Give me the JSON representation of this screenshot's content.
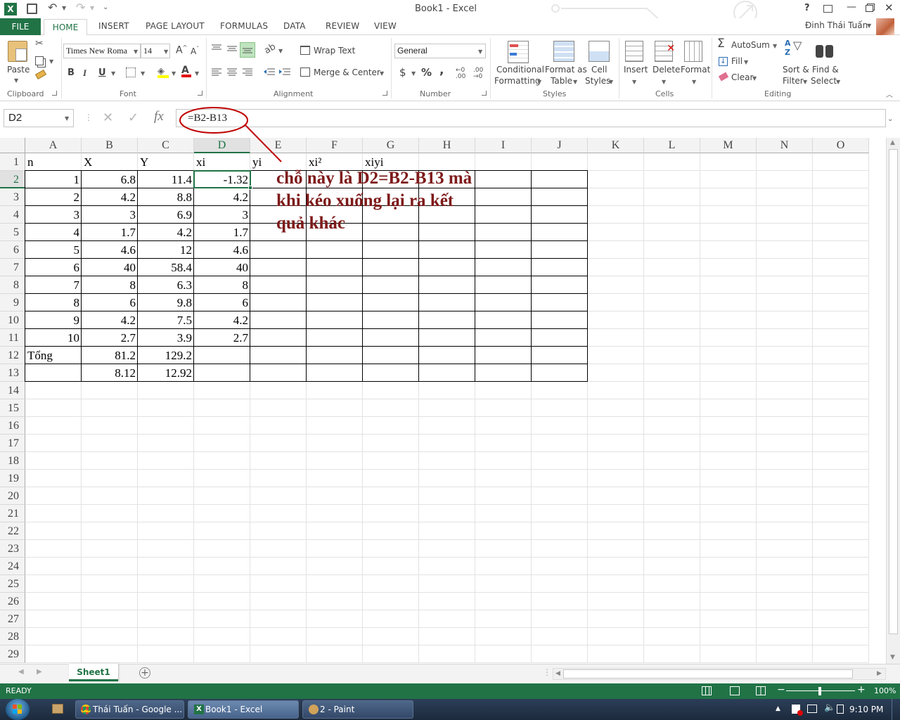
{
  "window": {
    "title": "Book1 - Excel",
    "help": "?",
    "user": "Đinh Thái Tuấn"
  },
  "tabs": [
    "FILE",
    "HOME",
    "INSERT",
    "PAGE LAYOUT",
    "FORMULAS",
    "DATA",
    "REVIEW",
    "VIEW"
  ],
  "ribbon": {
    "clipboard": {
      "paste": "Paste",
      "label": "Clipboard"
    },
    "font": {
      "name": "Times New Roma",
      "size": "14",
      "label": "Font",
      "bold": "B",
      "italic": "I",
      "underline": "U"
    },
    "alignment": {
      "wrap": "Wrap Text",
      "merge": "Merge & Center",
      "label": "Alignment"
    },
    "number": {
      "format": "General",
      "currency": "$",
      "percent": "%",
      "comma": ",",
      "label": "Number"
    },
    "styles": {
      "conditional": "Conditional",
      "conditional2": "Formatting",
      "format_table": "Format as",
      "format_table2": "Table",
      "cell_styles": "Cell",
      "cell_styles2": "Styles",
      "label": "Styles"
    },
    "cells": {
      "insert": "Insert",
      "delete": "Delete",
      "format": "Format",
      "label": "Cells"
    },
    "editing": {
      "autosum": "AutoSum",
      "fill": "Fill",
      "clear": "Clear",
      "sort": "Sort &",
      "sort2": "Filter",
      "find": "Find &",
      "find2": "Select",
      "label": "Editing"
    }
  },
  "formula_bar": {
    "name_box": "D2",
    "formula": "=B2-B13",
    "fx": "fx"
  },
  "columns": [
    "A",
    "B",
    "C",
    "D",
    "E",
    "F",
    "G",
    "H",
    "I",
    "J",
    "K",
    "L",
    "M",
    "N",
    "O"
  ],
  "rows": [
    "1",
    "2",
    "3",
    "4",
    "5",
    "6",
    "7",
    "8",
    "9",
    "10",
    "11",
    "12",
    "13",
    "14",
    "15",
    "16",
    "17",
    "18",
    "19",
    "20",
    "21",
    "22",
    "23",
    "24",
    "25",
    "26",
    "27",
    "28",
    "29"
  ],
  "cells": {
    "A1": "n",
    "B1": "X",
    "C1": "Y",
    "D1": "xi",
    "E1": "yi",
    "F1": "xi²",
    "G1": "xiyi",
    "A2": "1",
    "B2": "6.8",
    "C2": "11.4",
    "D2": "-1.32",
    "A3": "2",
    "B3": "4.2",
    "C3": "8.8",
    "D3": "4.2",
    "A4": "3",
    "B4": "3",
    "C4": "6.9",
    "D4": "3",
    "A5": "4",
    "B5": "1.7",
    "C5": "4.2",
    "D5": "1.7",
    "A6": "5",
    "B6": "4.6",
    "C6": "12",
    "D6": "4.6",
    "A7": "6",
    "B7": "40",
    "C7": "58.4",
    "D7": "40",
    "A8": "7",
    "B8": "8",
    "C8": "6.3",
    "D8": "8",
    "A9": "8",
    "B9": "6",
    "C9": "9.8",
    "D9": "6",
    "A10": "9",
    "B10": "4.2",
    "C10": "7.5",
    "D10": "4.2",
    "A11": "10",
    "B11": "2.7",
    "C11": "3.9",
    "D11": "2.7",
    "A12": "Tổng",
    "B12": "81.2",
    "C12": "129.2",
    "B13": "8.12",
    "C13": "12.92"
  },
  "annotation": {
    "line1": "chỗ này là D2=B2-B13 mà",
    "line2": "khi kéo xuống lại ra kết",
    "line3": "quả khác"
  },
  "sheet_tab": "Sheet1",
  "status": {
    "ready": "READY",
    "zoom": "100%"
  },
  "taskbar": {
    "chrome": "Thái Tuấn - Google ...",
    "excel": "Book1 - Excel",
    "paint": "2 - Paint",
    "time": "9:10 PM"
  },
  "colors": {
    "accent": "#217346",
    "annotation": "#7e1a1a",
    "oval": "#c00000"
  }
}
